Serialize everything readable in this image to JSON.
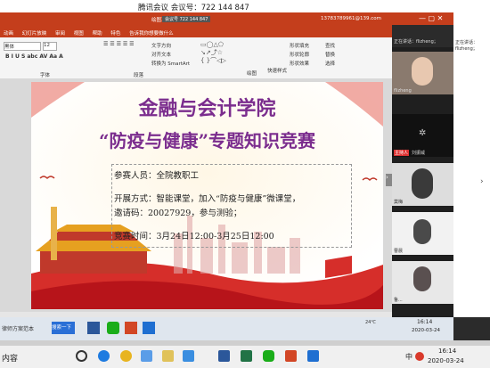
{
  "meeting": {
    "title": "腾讯会议 会议号：722 144 847",
    "id_badge": "会议号 722 144 847"
  },
  "ppt": {
    "tabs": [
      "动画",
      "幻灯片放映",
      "审阅",
      "视图",
      "帮助",
      "特色",
      "告诉我你想要做什么"
    ],
    "tool_tab": "绘图工具",
    "account": "13783789961@139.com",
    "ribbon": {
      "font_name": "黑体",
      "font_size": "12",
      "text_direction": "文字方向",
      "align_text": "对齐文本",
      "smartart": "转换为 SmartArt",
      "drawing": "绘图",
      "quick_styles": "快速样式",
      "shape_fill": "形状填充",
      "shape_outline": "形状轮廓",
      "shape_effects": "形状效果",
      "find": "查找",
      "replace": "替换",
      "select": "选择",
      "paragraph": "段落",
      "font_group": "字体"
    },
    "slide": {
      "title1": "金融与会计学院",
      "title2": "“防疫与健康”专题知识竞赛",
      "line1": "参赛人员：全院教职工",
      "line2": "开展方式：智能课堂，加入“防疫与健康”微课堂，",
      "line3": "邀请码：20027929，参与测验；",
      "line4": "竞赛时间：3月24日12:00-3月25日12:00"
    }
  },
  "side": {
    "speaking": "正在讲话：flizheng；",
    "users": [
      "flizheng",
      "主持人",
      "刘振威",
      "莫梅",
      "曹晨",
      "鲁..."
    ]
  },
  "remote_taskbar": {
    "search": "搜索一下",
    "doc": "律师方案范本",
    "time": "16:14",
    "date": "2020-03-24",
    "temp": "24℃"
  },
  "local_taskbar": {
    "left_text": "内容",
    "time": "16:14",
    "date": "2020-03-24",
    "ime": "中"
  }
}
